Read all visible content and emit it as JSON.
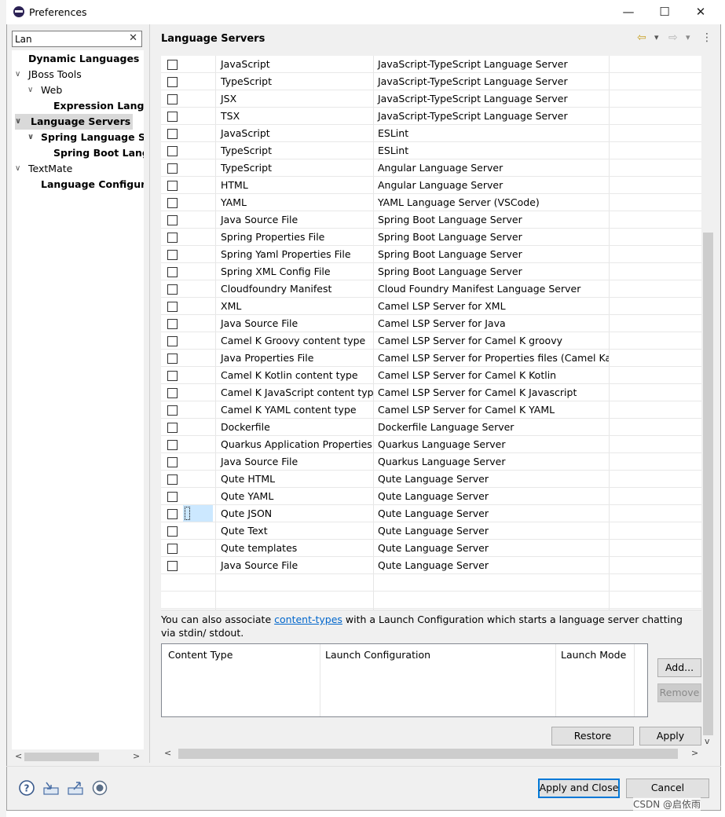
{
  "window": {
    "title": "Preferences",
    "minimize": "—",
    "maximize": "☐",
    "close": "✕"
  },
  "search": {
    "value": "Lan",
    "clear": "✕"
  },
  "tree": [
    {
      "label": "Dynamic Languages",
      "bold": true,
      "twisty": "",
      "indent": 0
    },
    {
      "label": "JBoss Tools",
      "bold": false,
      "twisty": "∨",
      "indent": 0
    },
    {
      "label": "Web",
      "bold": false,
      "twisty": "∨",
      "indent": 1
    },
    {
      "label": "Expression Langua",
      "bold": true,
      "twisty": "",
      "indent": 2
    },
    {
      "label": "Language Servers",
      "bold": true,
      "twisty": "∨",
      "indent": 0,
      "selected": true
    },
    {
      "label": "Spring Language Serv",
      "bold": true,
      "twisty": "∨",
      "indent": 1
    },
    {
      "label": "Spring Boot Langu",
      "bold": true,
      "twisty": "",
      "indent": 2
    },
    {
      "label": "TextMate",
      "bold": false,
      "twisty": "∨",
      "indent": 0
    },
    {
      "label": "Language Configurat",
      "bold": true,
      "twisty": "",
      "indent": 1
    }
  ],
  "page": {
    "title": "Language Servers",
    "back": "⇦",
    "forward": "⇨",
    "dropdown": "▾",
    "menu": "⋮"
  },
  "table": {
    "rows": [
      {
        "content_type": "JavaScript",
        "server": "JavaScript-TypeScript Language Server"
      },
      {
        "content_type": "TypeScript",
        "server": "JavaScript-TypeScript Language Server"
      },
      {
        "content_type": "JSX",
        "server": "JavaScript-TypeScript Language Server"
      },
      {
        "content_type": "TSX",
        "server": "JavaScript-TypeScript Language Server"
      },
      {
        "content_type": "JavaScript",
        "server": "ESLint"
      },
      {
        "content_type": "TypeScript",
        "server": "ESLint"
      },
      {
        "content_type": "TypeScript",
        "server": "Angular Language Server"
      },
      {
        "content_type": "HTML",
        "server": "Angular Language Server"
      },
      {
        "content_type": "YAML",
        "server": "YAML Language Server (VSCode)"
      },
      {
        "content_type": "Java Source File",
        "server": "Spring Boot Language Server"
      },
      {
        "content_type": "Spring Properties File",
        "server": "Spring Boot Language Server"
      },
      {
        "content_type": "Spring Yaml Properties File",
        "server": "Spring Boot Language Server"
      },
      {
        "content_type": "Spring XML Config File",
        "server": "Spring Boot Language Server"
      },
      {
        "content_type": "Cloudfoundry Manifest",
        "server": "Cloud Foundry Manifest Language Server"
      },
      {
        "content_type": "XML",
        "server": "Camel LSP Server for XML"
      },
      {
        "content_type": "Java Source File",
        "server": "Camel LSP Server for Java"
      },
      {
        "content_type": "Camel K Groovy content type",
        "server": "Camel LSP Server for Camel K groovy"
      },
      {
        "content_type": "Java Properties File",
        "server": "Camel LSP Server for Properties files (Camel Ka..."
      },
      {
        "content_type": "Camel K Kotlin content type",
        "server": "Camel LSP Server for Camel K Kotlin"
      },
      {
        "content_type": "Camel K JavaScript content type",
        "server": "Camel LSP Server for Camel K Javascript"
      },
      {
        "content_type": "Camel K YAML content type",
        "server": "Camel LSP Server for Camel K YAML"
      },
      {
        "content_type": "Dockerfile",
        "server": "Dockerfile Language Server"
      },
      {
        "content_type": "Quarkus Application Properties",
        "server": "Quarkus Language Server"
      },
      {
        "content_type": "Java Source File",
        "server": "Quarkus Language Server"
      },
      {
        "content_type": "Qute HTML",
        "server": "Qute Language Server"
      },
      {
        "content_type": "Qute YAML",
        "server": "Qute Language Server"
      },
      {
        "content_type": "Qute JSON",
        "server": "Qute Language Server",
        "focused": true
      },
      {
        "content_type": "Qute Text",
        "server": "Qute Language Server"
      },
      {
        "content_type": "Qute templates",
        "server": "Qute Language Server"
      },
      {
        "content_type": "Java Source File",
        "server": "Qute Language Server"
      }
    ]
  },
  "association": {
    "text_before": "You can also associate ",
    "link": "content-types",
    "text_after": " with a Launch Configuration which starts a language server chatting via stdin/ stdout."
  },
  "launch_table": {
    "col1": "Content Type",
    "col2": "Launch Configuration",
    "col3": "Launch Mode"
  },
  "buttons": {
    "add": "Add...",
    "remove": "Remove",
    "restore_defaults": "Restore Defaults",
    "apply": "Apply",
    "apply_and_close": "Apply and Close",
    "cancel": "Cancel"
  },
  "scroll": {
    "left": "<",
    "right": ">",
    "up": "^",
    "down": "v"
  },
  "watermark": "CSDN @启依雨"
}
